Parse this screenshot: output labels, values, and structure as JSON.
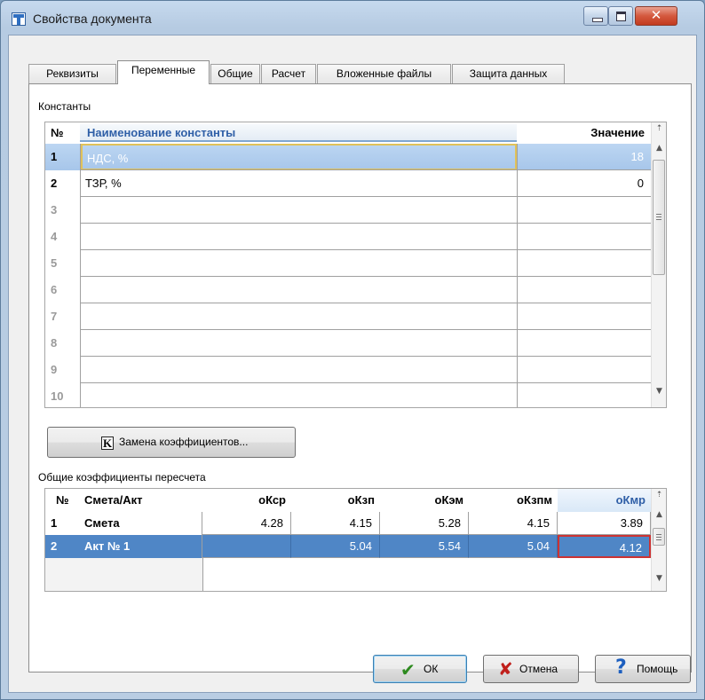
{
  "window": {
    "title": "Свойства документа",
    "min_glyph": "",
    "close_glyph": "✕"
  },
  "tabs": [
    "Реквизиты",
    "Переменные",
    "Общие",
    "Расчет",
    "Вложенные файлы",
    "Защита данных"
  ],
  "active_tab": "Переменные",
  "constants": {
    "group_label": "Константы",
    "headers": {
      "num": "№",
      "name": "Наименование константы",
      "value": "Значение"
    },
    "rows": [
      {
        "num": "1",
        "name": "НДС, %",
        "value": "18",
        "selected": true
      },
      {
        "num": "2",
        "name": "ТЗР, %",
        "value": "0"
      },
      {
        "num": "3",
        "name": "",
        "value": ""
      },
      {
        "num": "4",
        "name": "",
        "value": ""
      },
      {
        "num": "5",
        "name": "",
        "value": ""
      },
      {
        "num": "6",
        "name": "",
        "value": ""
      },
      {
        "num": "7",
        "name": "",
        "value": ""
      },
      {
        "num": "8",
        "name": "",
        "value": ""
      },
      {
        "num": "9",
        "name": "",
        "value": ""
      },
      {
        "num": "10",
        "name": "",
        "value": ""
      }
    ]
  },
  "replace_button": {
    "icon": "k-icon",
    "icon_glyph": "K",
    "label": "Замена коэффициентов..."
  },
  "coefficients": {
    "group_label": "Общие коэффициенты пересчета",
    "headers": [
      "№",
      "Смета/Акт",
      "оКср",
      "оКзп",
      "оКэм",
      "оКзпм",
      "оКмр"
    ],
    "rows": [
      {
        "num": "1",
        "name": "Смета",
        "values": [
          "4.28",
          "4.15",
          "5.28",
          "4.15",
          "3.89"
        ]
      },
      {
        "num": "2",
        "name": "Акт № 1",
        "values": [
          "",
          "5.04",
          "5.54",
          "5.04",
          "4.12"
        ],
        "selected": true
      }
    ]
  },
  "footer": {
    "ok": "ОК",
    "cancel": "Отмена",
    "help": "Помощь"
  },
  "colors": {
    "selection": "#4f86c6",
    "header_accent": "#2f5fa7",
    "focus_border": "#cc3333",
    "ok_check": "#2d8a1f",
    "cancel_x": "#c0201c",
    "help_q": "#1d5fbf"
  }
}
